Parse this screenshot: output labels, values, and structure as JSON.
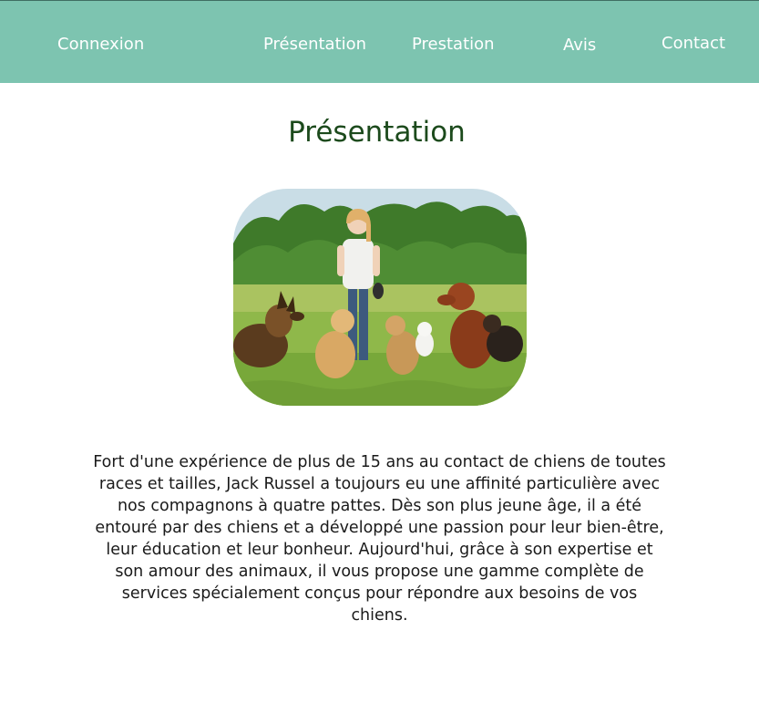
{
  "nav": {
    "items": [
      {
        "label": "Connexion"
      },
      {
        "label": "Présentation"
      },
      {
        "label": "Prestation"
      },
      {
        "label": "Avis"
      },
      {
        "label": "Contact"
      }
    ]
  },
  "main": {
    "title": "Présentation",
    "paragraph": "Fort d'une expérience de plus de 15 ans au contact de chiens de toutes races et tailles, Jack Russel a toujours eu une affinité particulière avec nos compagnons à quatre pattes. Dès son plus jeune âge, il a été entouré par des chiens et a développé une passion pour leur bien-être, leur éducation et leur bonheur. Aujourd'hui, grâce à son expertise et son amour des animaux, il vous propose une gamme complète de services spécialement conçus pour répondre aux besoins de vos chiens."
  },
  "colors": {
    "nav_background": "#7dc4b0",
    "nav_text": "#ffffff",
    "title": "#1c4a1c",
    "body_text": "#1a1a1a"
  }
}
